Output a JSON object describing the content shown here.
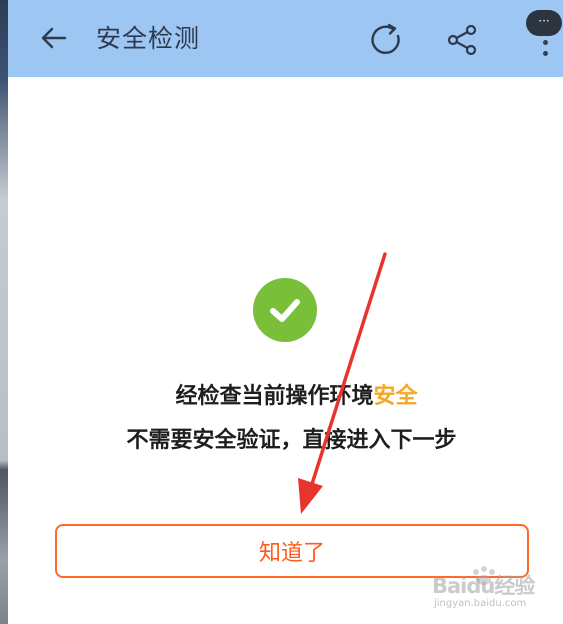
{
  "header": {
    "title": "安全检测",
    "more_bubble": "···"
  },
  "result": {
    "line1_prefix": "经检查当前操作环境",
    "line1_highlight": "安全",
    "line2": "不需要安全验证，直接进入下一步"
  },
  "actions": {
    "confirm_label": "知道了"
  },
  "watermark": {
    "brand": "Baidu经验",
    "url": "jingyan.baidu.com"
  },
  "colors": {
    "header_bg": "#9dc6f2",
    "success_green": "#79bf3a",
    "highlight_orange": "#f5a623",
    "button_orange": "#ff5a1f",
    "annotation_arrow": "#e8342e"
  },
  "icons": {
    "back": "arrow-left-icon",
    "refresh": "refresh-icon",
    "share": "share-icon",
    "more": "more-vertical-icon",
    "success": "check-circle-icon"
  }
}
